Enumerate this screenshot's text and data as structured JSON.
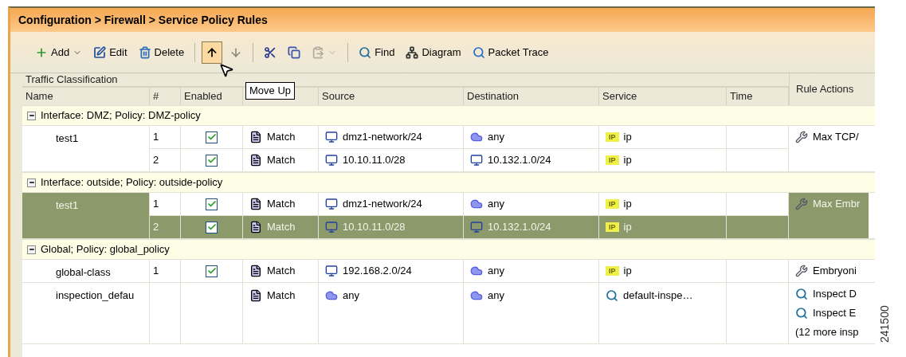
{
  "window": {
    "title": "Configuration > Firewall > Service Policy Rules"
  },
  "toolbar": [
    {
      "kind": "add",
      "label": "Add",
      "dropdown": true,
      "disabled": false,
      "highlighted": false
    },
    {
      "kind": "edit",
      "label": "Edit",
      "dropdown": false,
      "disabled": false,
      "highlighted": false
    },
    {
      "kind": "delete",
      "label": "Delete",
      "dropdown": false,
      "disabled": false,
      "highlighted": false
    },
    {
      "kind": "separator"
    },
    {
      "kind": "up",
      "dropdown": false,
      "disabled": false,
      "highlighted": true
    },
    {
      "kind": "down",
      "dropdown": false,
      "disabled": true,
      "highlighted": false
    },
    {
      "kind": "separator"
    },
    {
      "kind": "cut",
      "dropdown": false,
      "disabled": false,
      "highlighted": false
    },
    {
      "kind": "copy",
      "dropdown": false,
      "disabled": false,
      "highlighted": false
    },
    {
      "kind": "paste",
      "dropdown": true,
      "disabled": true,
      "highlighted": false
    },
    {
      "kind": "separator"
    },
    {
      "kind": "find",
      "label": "Find",
      "dropdown": false,
      "disabled": false,
      "highlighted": false
    },
    {
      "kind": "diagram",
      "label": "Diagram",
      "dropdown": false,
      "disabled": false,
      "highlighted": false
    },
    {
      "kind": "trace",
      "label": "Packet Trace",
      "dropdown": false,
      "disabled": false,
      "highlighted": false
    }
  ],
  "tooltip": "Move Up",
  "table": {
    "group_header": "Traffic Classification",
    "columns": [
      "Name",
      "#",
      "Enabled",
      "",
      "Source",
      "Destination",
      "Service",
      "Time"
    ],
    "actions_column": "Rule Actions",
    "groups": [
      {
        "label": "Interface: DMZ; Policy: DMZ-policy",
        "expanded": true,
        "rules": [
          {
            "name": "test1",
            "selected": false,
            "conditions": [
              {
                "number": "1",
                "enabled": true,
                "match": "Match",
                "source": {
                  "kind": "network",
                  "text": "dmz1-network/24"
                },
                "destination": {
                  "kind": "any",
                  "text": "any"
                },
                "service": {
                  "kind": "ip",
                  "tag": "IP",
                  "text": "ip"
                },
                "selected": false
              },
              {
                "number": "2",
                "enabled": true,
                "match": "Match",
                "source": {
                  "kind": "network",
                  "text": "10.10.11.0/28"
                },
                "destination": {
                  "kind": "network",
                  "text": "10.132.1.0/24"
                },
                "service": {
                  "kind": "ip",
                  "tag": "IP",
                  "text": "ip"
                },
                "selected": false
              }
            ],
            "actions": [
              {
                "kind": "connection",
                "text": "Max TCP/"
              }
            ]
          }
        ]
      },
      {
        "label": "Interface: outside; Policy: outside-policy",
        "expanded": true,
        "rules": [
          {
            "name": "test1",
            "selected": true,
            "conditions": [
              {
                "number": "1",
                "enabled": true,
                "match": "Match",
                "source": {
                  "kind": "network",
                  "text": "dmz1-network/24"
                },
                "destination": {
                  "kind": "any",
                  "text": "any"
                },
                "service": {
                  "kind": "ip",
                  "tag": "IP",
                  "text": "ip"
                },
                "selected": false
              },
              {
                "number": "2",
                "enabled": true,
                "match": "Match",
                "source": {
                  "kind": "network",
                  "text": "10.10.11.0/28"
                },
                "destination": {
                  "kind": "network",
                  "text": "10.132.1.0/24"
                },
                "service": {
                  "kind": "ip",
                  "tag": "IP",
                  "text": "ip"
                },
                "selected": true
              }
            ],
            "actions": [
              {
                "kind": "connection",
                "text": "Max Embr"
              }
            ]
          }
        ]
      },
      {
        "label": "Global; Policy: global_policy",
        "expanded": true,
        "rules": [
          {
            "name": "global-class",
            "selected": false,
            "conditions": [
              {
                "number": "1",
                "enabled": true,
                "match": "Match",
                "source": {
                  "kind": "network",
                  "text": "192.168.2.0/24"
                },
                "destination": {
                  "kind": "any",
                  "text": "any"
                },
                "service": {
                  "kind": "ip",
                  "tag": "IP",
                  "text": "ip"
                },
                "selected": false
              }
            ],
            "actions": [
              {
                "kind": "connection",
                "text": "Embryoni"
              }
            ]
          },
          {
            "name": "inspection_defau",
            "selected": false,
            "conditions": [
              {
                "match": "Match",
                "source": {
                  "kind": "any",
                  "text": "any"
                },
                "destination": {
                  "kind": "any",
                  "text": "any"
                },
                "service": {
                  "kind": "inspect",
                  "text": "default-inspe…"
                },
                "selected": false
              }
            ],
            "actions": [
              {
                "kind": "inspect",
                "text": "Inspect D"
              },
              {
                "kind": "inspect",
                "text": "Inspect E"
              },
              {
                "kind": "text",
                "text": "(12 more insp"
              }
            ]
          }
        ]
      }
    ]
  },
  "figure_number": "241500"
}
